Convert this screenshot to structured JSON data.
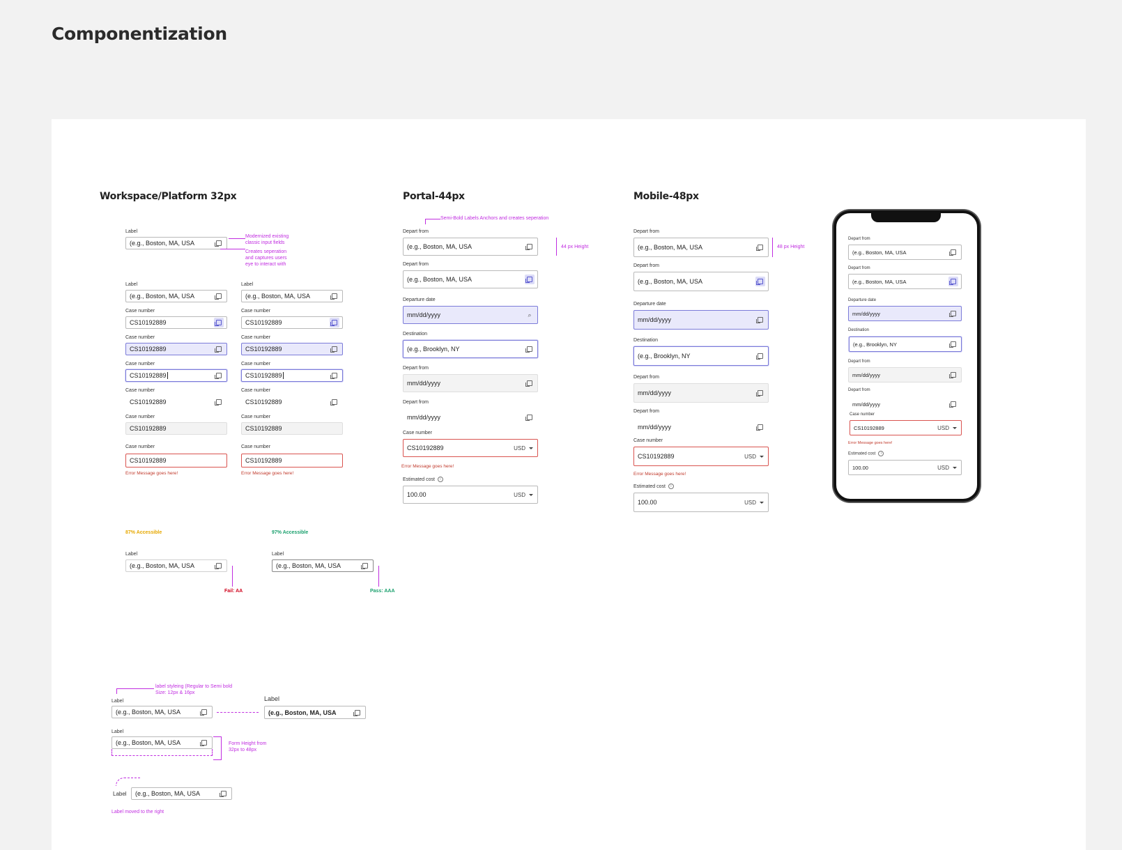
{
  "page_title": "Componentization",
  "sections": {
    "workspace": "Workspace/Platform 32px",
    "portal": "Portal-44px",
    "mobile": "Mobile-48px"
  },
  "placeholders": {
    "location": "(e.g., Boston, MA, USA",
    "destination": "(e.g., Brooklyn, NY",
    "date": "mm/dd/yyyy",
    "case": "CS10192889",
    "cost": "100.00",
    "currency": "USD"
  },
  "labels": {
    "label": "Label",
    "case_number": "Case number",
    "depart_from": "Depart from",
    "departure_date": "Departure date",
    "destination": "Destination",
    "estimated_cost": "Estimated cost",
    "error": "Error Message goes here!"
  },
  "notes": {
    "modernized": "Modernized existing\nclassic input fields",
    "separation": "Creates seperation\nand captures users\neye to interact with",
    "semibold": "Semi-Bold Labels Anchors and creates seperation",
    "h44": "44 px Height",
    "h48": "48 px Height",
    "acc87": "87% Accessible",
    "acc97": "97% Accessible",
    "fail": "Fail: AA",
    "pass": "Pass: AAA",
    "label_styling": "label styleing (Regular to Semi bold\nSize: 12px & 16px",
    "form_height": "Form Height from\n32px to 48px",
    "moved_right": "Label moved to the right"
  },
  "colors": {
    "annotation": "#c02ce0",
    "error": "#d9534f",
    "focus": "#7b7bd9",
    "accessible_87": "#e6a800",
    "accessible_97": "#1aa06d",
    "fail": "#d0021b",
    "pass": "#1aa06d"
  },
  "icons": [
    "copy-icon",
    "search-icon",
    "caret-down-icon",
    "info-icon"
  ]
}
